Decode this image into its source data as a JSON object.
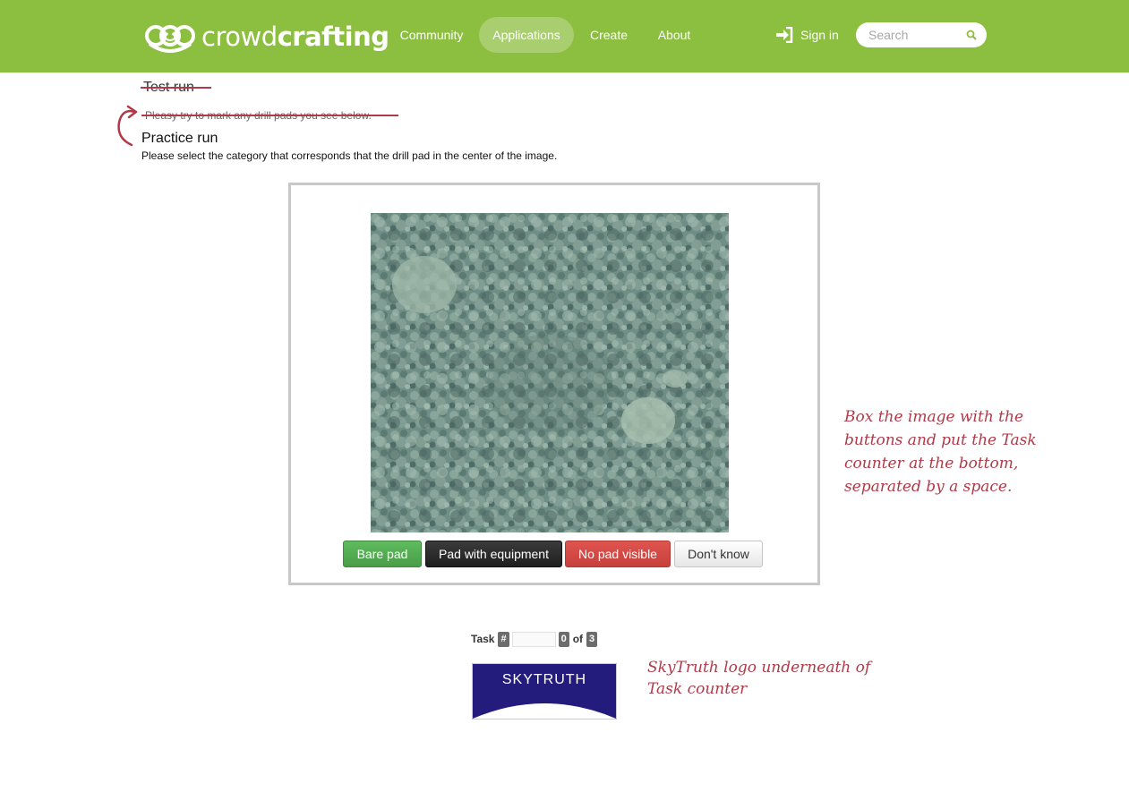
{
  "brand": {
    "name_light": "crowd",
    "name_bold": "crafting"
  },
  "nav": {
    "items": [
      {
        "label": "Community",
        "active": false
      },
      {
        "label": "Applications",
        "active": true
      },
      {
        "label": "Create",
        "active": false
      },
      {
        "label": "About",
        "active": false
      }
    ],
    "signin_label": "Sign in",
    "search_placeholder": "Search",
    "bar_color": "#8cbe3f"
  },
  "content": {
    "old_title": "Test run",
    "old_instruction": "Pleasy try to mark any drill pads you see below.",
    "title": "Practice run",
    "instruction": "Please select the category that corresponds that the drill pad in the center of the image."
  },
  "buttons": {
    "bare": "Bare pad",
    "equipment": "Pad with equipment",
    "no_pad": "No pad visible",
    "dont_know": "Don't know"
  },
  "task_counter": {
    "label": "Task",
    "hash": "#",
    "current": "0",
    "of_label": "of",
    "total": "3"
  },
  "skytruth_logo": {
    "text": "SKYTRUTH"
  },
  "annotations": {
    "box_note": "Box the image with the buttons and put the Task counter at the bottom, separated by a space.",
    "logo_note": "SkyTruth logo underneath of Task counter"
  }
}
